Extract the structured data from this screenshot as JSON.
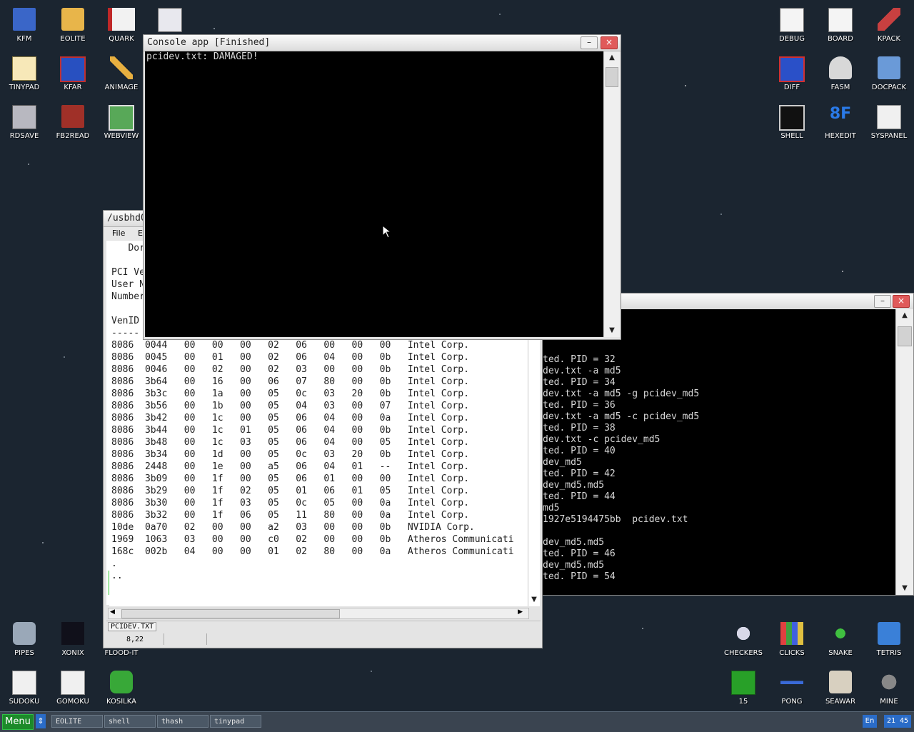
{
  "desktop": {
    "left_icons": [
      {
        "label": "KFM",
        "icon": "floppy-icon"
      },
      {
        "label": "EOLITE",
        "icon": "folder-icon"
      },
      {
        "label": "QUARK",
        "icon": "book-icon"
      },
      {
        "label": "",
        "icon": "calculator-icon"
      },
      {
        "label": "TINYPAD",
        "icon": "notepad-icon"
      },
      {
        "label": "KFAR",
        "icon": "kfar-icon"
      },
      {
        "label": "ANIMAGE",
        "icon": "paint-icon"
      },
      {
        "label": "RDSAVE",
        "icon": "rdsave-icon"
      },
      {
        "label": "FB2READ",
        "icon": "fb2-icon"
      },
      {
        "label": "WEBVIEW",
        "icon": "globe-icon"
      }
    ],
    "right_icons": [
      {
        "label": "DEBUG",
        "icon": "debug-icon"
      },
      {
        "label": "BOARD",
        "icon": "board-icon"
      },
      {
        "label": "KPACK",
        "icon": "kpack-icon"
      },
      {
        "label": "DIFF",
        "icon": "diff-icon"
      },
      {
        "label": "FASM",
        "icon": "fasm-icon"
      },
      {
        "label": "DOCPACK",
        "icon": "docpack-icon"
      },
      {
        "label": "SHELL",
        "icon": "shell-icon"
      },
      {
        "label": "HEXEDIT",
        "icon": "hexedit-icon"
      },
      {
        "label": "SYSPANEL",
        "icon": "syspanel-icon"
      }
    ],
    "bottom_left_icons": [
      {
        "label": "PIPES",
        "icon": "pipes-icon"
      },
      {
        "label": "XONIX",
        "icon": "xonix-icon"
      },
      {
        "label": "FLOOD-IT",
        "icon": "flood-icon"
      },
      {
        "label": "SUDOKU",
        "icon": "sudoku-icon"
      },
      {
        "label": "GOMOKU",
        "icon": "gomoku-icon"
      },
      {
        "label": "KOSILKA",
        "icon": "mower-icon"
      }
    ],
    "bottom_right_icons": [
      {
        "label": "CHECKERS",
        "icon": "checkers-icon"
      },
      {
        "label": "CLICKS",
        "icon": "clicks-icon"
      },
      {
        "label": "SNAKE",
        "icon": "snake-icon"
      },
      {
        "label": "TETRIS",
        "icon": "tetris-icon"
      },
      {
        "label": "15",
        "icon": "fifteen-icon"
      },
      {
        "label": "PONG",
        "icon": "pong-icon"
      },
      {
        "label": "SEAWAR",
        "icon": "ship-icon"
      },
      {
        "label": "MINE",
        "icon": "mine-icon"
      }
    ]
  },
  "console_window": {
    "title": "Console app [Finished]",
    "minimize": "–",
    "close": "×",
    "output": "pcidev.txt: DAMAGED!"
  },
  "shell_window": {
    "minimize": "–",
    "close": "×",
    "lines": [
      "ted. PID = 32",
      "dev.txt -a md5",
      "ted. PID = 34",
      "dev.txt -a md5 -g pcidev_md5",
      "ted. PID = 36",
      "dev.txt -a md5 -c pcidev_md5",
      "ted. PID = 38",
      "dev.txt -c pcidev_md5",
      "ted. PID = 40",
      "dev_md5",
      "ted. PID = 42",
      "dev_md5.md5",
      "ted. PID = 44",
      "md5",
      "1927e5194475bb  pcidev.txt",
      "",
      "dev_md5.md5",
      "ted. PID = 46",
      "dev_md5.md5",
      "ted. PID = 54"
    ]
  },
  "tinypad_window": {
    "title": "/usbhd0",
    "menu_file": "File",
    "menu_edit": "E",
    "header_lines": [
      "   Dor",
      "",
      "PCI Ve",
      "User N",
      "Number",
      "",
      "VenID"
    ],
    "separator": "----- ----- ---- ---- --- ---  -----  --------- --- --------------------",
    "rows": [
      "8086  0044   00   00   00   02   06   00   00   00   Intel Corp.",
      "8086  0045   00   01   00   02   06   04   00   0b   Intel Corp.",
      "8086  0046   00   02   00   02   03   00   00   0b   Intel Corp.",
      "8086  3b64   00   16   00   06   07   80   00   0b   Intel Corp.",
      "8086  3b3c   00   1a   00   05   0c   03   20   0b   Intel Corp.",
      "8086  3b56   00   1b   00   05   04   03   00   07   Intel Corp.",
      "8086  3b42   00   1c   00   05   06   04   00   0a   Intel Corp.",
      "8086  3b44   00   1c   01   05   06   04   00   0b   Intel Corp.",
      "8086  3b48   00   1c   03   05   06   04   00   05   Intel Corp.",
      "8086  3b34   00   1d   00   05   0c   03   20   0b   Intel Corp.",
      "8086  2448   00   1e   00   a5   06   04   01   --   Intel Corp.",
      "8086  3b09   00   1f   00   05   06   01   00   00   Intel Corp.",
      "8086  3b29   00   1f   02   05   01   06   01   05   Intel Corp.",
      "8086  3b30   00   1f   03   05   0c   05   00   0a   Intel Corp.",
      "8086  3b32   00   1f   06   05   11   80   00   0a   Intel Corp.",
      "10de  0a70   02   00   00   a2   03   00   00   0b   NVIDIA Corp.",
      "1969  1063   03   00   00   c0   02   00   00   0b   Atheros Communicati",
      "168c  002b   04   00   00   01   02   80   00   0a   Atheros Communicati",
      ".",
      ".."
    ],
    "tab": "PCIDEV.TXT",
    "status_pos": "8,22"
  },
  "taskbar": {
    "menu": "Menu",
    "switch": "⇕",
    "tasks": [
      "EOLITE",
      "shell",
      "thash",
      "tinypad"
    ],
    "lang": "En",
    "clock": "21 45"
  }
}
